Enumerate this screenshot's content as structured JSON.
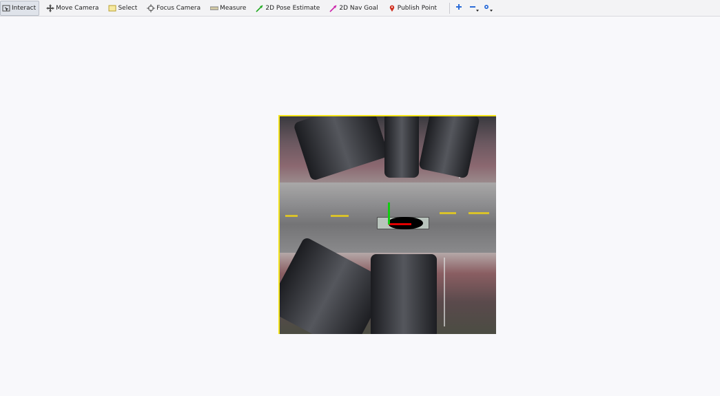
{
  "toolbar": {
    "tools": [
      {
        "label": "Interact",
        "icon": "interact-icon",
        "active": true
      },
      {
        "label": "Move Camera",
        "icon": "move-camera-icon"
      },
      {
        "label": "Select",
        "icon": "select-icon"
      },
      {
        "label": "Focus Camera",
        "icon": "focus-camera-icon"
      },
      {
        "label": "Measure",
        "icon": "measure-icon"
      },
      {
        "label": "2D Pose Estimate",
        "icon": "pose-arrow-icon",
        "color": "#22aa22"
      },
      {
        "label": "2D Nav Goal",
        "icon": "nav-goal-arrow-icon",
        "color": "#cc22aa"
      },
      {
        "label": "Publish Point",
        "icon": "map-pin-icon",
        "color": "#d03020"
      }
    ],
    "extra_icons": [
      "add-tool-icon",
      "remove-tool-icon",
      "camera-view-icon"
    ]
  },
  "viewport": {
    "image_border_color": "#f5e51a",
    "axis_colors": {
      "x": "#e20000",
      "y": "#11cc11"
    }
  }
}
